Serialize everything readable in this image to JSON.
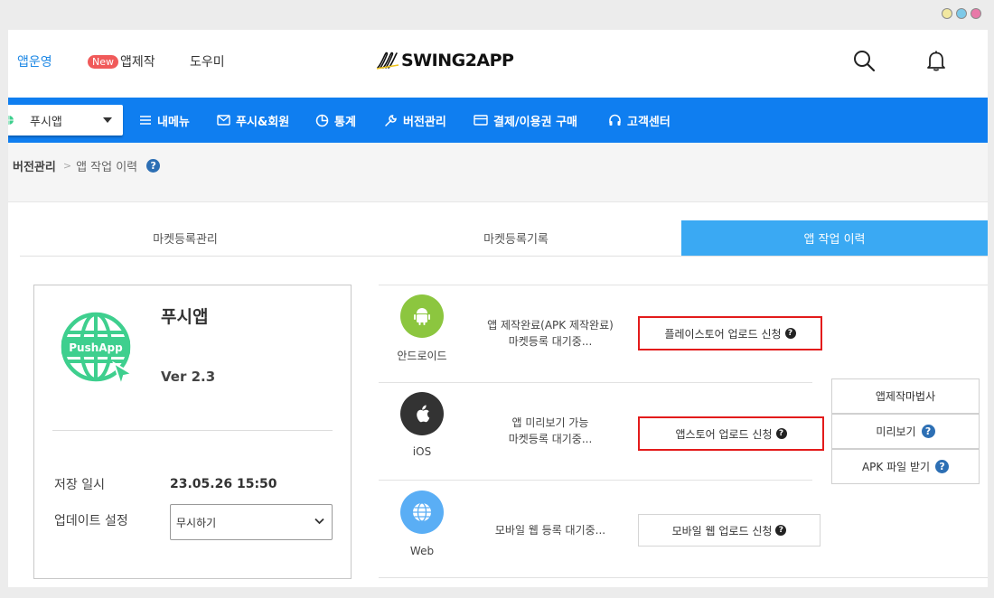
{
  "window": {
    "dot_colors": [
      "#f2e8a0",
      "#7dc9e8",
      "#e879a8"
    ]
  },
  "header": {
    "nav": [
      {
        "label": "앱운영",
        "active": true
      },
      {
        "label": "앱제작",
        "badge": "New"
      },
      {
        "label": "도우미"
      }
    ],
    "logo_text": "SWING2APP",
    "icons": [
      "search-icon",
      "bell-icon"
    ]
  },
  "menubar": {
    "app_select": "푸시앱",
    "items": [
      {
        "label": "내메뉴",
        "icon": "hamburger-icon"
      },
      {
        "label": "푸시&회원",
        "icon": "mail-icon"
      },
      {
        "label": "통계",
        "icon": "pie-chart-icon"
      },
      {
        "label": "버전관리",
        "icon": "wrench-icon"
      },
      {
        "label": "결제/이용권 구매",
        "icon": "card-icon"
      },
      {
        "label": "고객센터",
        "icon": "headset-icon"
      }
    ],
    "color": "#0f7ef0"
  },
  "breadcrumb": {
    "root": "버전관리",
    "separator": ">",
    "current": "앱 작업 이력",
    "help": "?"
  },
  "tabs": [
    {
      "label": "마켓등록관리",
      "active": false
    },
    {
      "label": "마켓등록기록",
      "active": false
    },
    {
      "label": "앱 작업 이력",
      "active": true
    }
  ],
  "app_card": {
    "name": "푸시앱",
    "icon_text": "PushApp",
    "version": "Ver 2.3",
    "saved_label": "저장 일시",
    "saved_value": "23.05.26 15:50",
    "update_label": "업데이트 설정",
    "update_value": "무시하기"
  },
  "platforms": [
    {
      "name": "안드로이드",
      "icon": "android-icon",
      "icon_color": "#8cc63f",
      "status_line1": "앱 제작완료(APK 제작완료)",
      "status_line2": "마켓등록 대기중...",
      "button": "플레이스토어 업로드 신청",
      "highlight": true
    },
    {
      "name": "iOS",
      "icon": "apple-icon",
      "icon_color": "#333333",
      "status_line1": "앱 미리보기 가능",
      "status_line2": "마켓등록 대기중...",
      "button": "앱스토어 업로드 신청",
      "highlight": true
    },
    {
      "name": "Web",
      "icon": "globe-icon",
      "icon_color": "#5aaef5",
      "status_line1": "모바일 웹 등록 대기중...",
      "status_line2": "",
      "button": "모바일 웹 업로드 신청",
      "highlight": false
    }
  ],
  "side_buttons": [
    {
      "label": "앱제작마법사",
      "help": false
    },
    {
      "label": "미리보기",
      "help": true
    },
    {
      "label": "APK 파일 받기",
      "help": true
    }
  ],
  "help_mark": "?"
}
